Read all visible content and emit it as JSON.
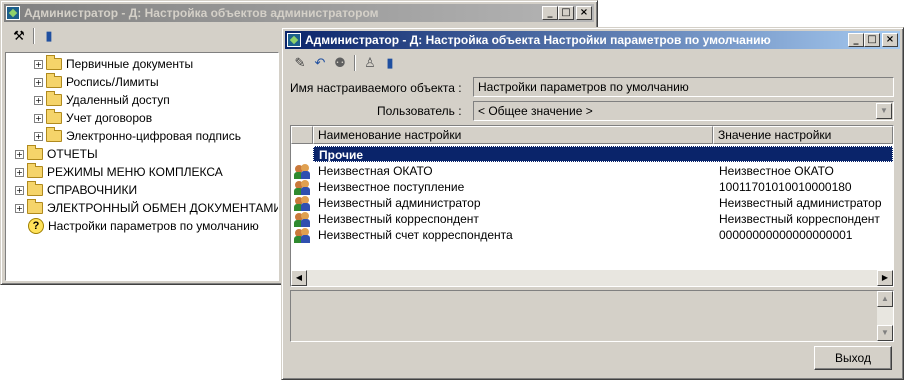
{
  "window_back": {
    "title": "Администратор - Д: Настройка объектов администратором",
    "tree": [
      {
        "label": "Первичные документы",
        "level": 1
      },
      {
        "label": "Роспись/Лимиты",
        "level": 1
      },
      {
        "label": "Удаленный доступ",
        "level": 1
      },
      {
        "label": "Учет договоров",
        "level": 1
      },
      {
        "label": "Электронно-цифровая подпись",
        "level": 1
      },
      {
        "label": "ОТЧЕТЫ",
        "level": 0
      },
      {
        "label": "РЕЖИМЫ МЕНЮ КОМПЛЕКСА",
        "level": 0
      },
      {
        "label": "СПРАВОЧНИКИ",
        "level": 0
      },
      {
        "label": "ЭЛЕКТРОННЫЙ ОБМЕН ДОКУМЕНТАМИ",
        "level": 0
      },
      {
        "label": "Настройки параметров по умолчанию",
        "level": 0
      }
    ]
  },
  "window_front": {
    "title": "Администратор - Д: Настройка объекта Настройки параметров по умолчанию",
    "object_name_label": "Имя настраиваемого объекта :",
    "object_name_value": "Настройки параметров по умолчанию",
    "user_label": "Пользователь :",
    "user_value": "< Общее значение >",
    "columns": [
      "Наименование настройки",
      "Значение настройки"
    ],
    "group": "Прочие",
    "rows": [
      {
        "name": "Неизвестная ОКАТО",
        "value": "Неизвестное ОКАТО"
      },
      {
        "name": "Неизвестное поступление",
        "value": "10011701010010000180"
      },
      {
        "name": "Неизвестный администратор",
        "value": "Неизвестный администратор"
      },
      {
        "name": "Неизвестный корреспондент",
        "value": "Неизвестный корреспондент"
      },
      {
        "name": "Неизвестный счет корреспондента",
        "value": "00000000000000000001"
      }
    ],
    "exit_button": "Выход"
  },
  "icons": [
    "minimize-icon",
    "maximize-icon",
    "close-icon",
    "tools-icon",
    "book-icon",
    "edit-icon",
    "undo-icon",
    "users-icon",
    "user-icon",
    "folder-icon",
    "question-icon",
    "person-icon"
  ]
}
